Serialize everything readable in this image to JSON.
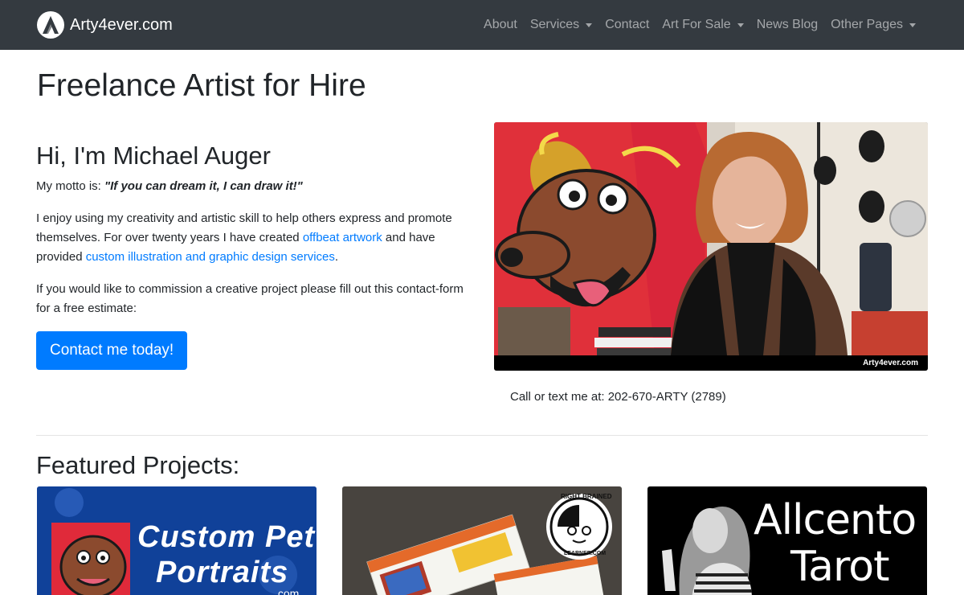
{
  "brand": {
    "name": "Arty4ever.com",
    "logo_icon": "arty4ever-logo-icon"
  },
  "nav": {
    "items": [
      {
        "label": "About",
        "dropdown": false
      },
      {
        "label": "Services",
        "dropdown": true
      },
      {
        "label": "Contact",
        "dropdown": false
      },
      {
        "label": "Art For Sale",
        "dropdown": true
      },
      {
        "label": "News Blog",
        "dropdown": false
      },
      {
        "label": "Other Pages",
        "dropdown": true
      }
    ]
  },
  "page": {
    "title": "Freelance Artist for Hire"
  },
  "intro": {
    "heading": "Hi, I'm Michael Auger",
    "motto_prefix": "My motto is: ",
    "motto_quote": "\"If you can dream it, I can draw it!\"",
    "p1_part1": "I enjoy using my creativity and artistic skill to help others express and promote themselves. For over twenty years I have created ",
    "p1_link1": "offbeat artwork",
    "p1_part2": " and have provided ",
    "p1_link2": "custom illustration and graphic design services",
    "p1_part3": ".",
    "p2": "If you would like to commission a creative project please fill out this contact-form for a free estimate:",
    "cta_label": "Contact me today!"
  },
  "hero": {
    "watermark": "Arty4ever.com"
  },
  "phone_line": "Call or text me at: 202-670-ARTY (2789)",
  "featured": {
    "title": "Featured Projects:",
    "cards": [
      {
        "line1": "Custom Pet",
        "line2": "Portraits",
        "suffix": ".com"
      },
      {
        "badge_top": "RIGHT BRAINED",
        "badge_bottom": "LEARNER.COM"
      },
      {
        "line1": "Allcento",
        "line2": "Tarot"
      }
    ]
  },
  "colors": {
    "navbar": "#343a40",
    "primary": "#007bff",
    "text": "#212529",
    "link": "#007bff"
  }
}
